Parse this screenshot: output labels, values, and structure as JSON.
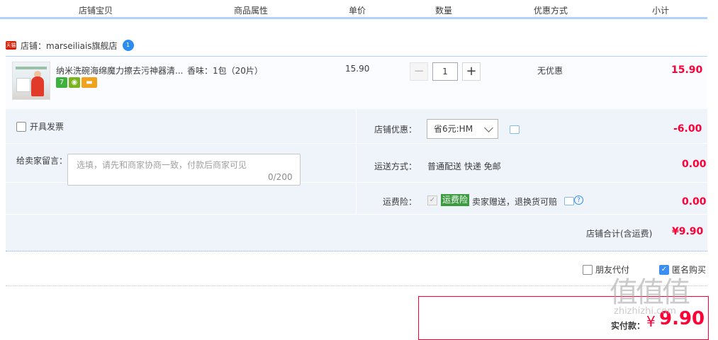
{
  "columns": [
    "店铺宝贝",
    "商品属性",
    "单价",
    "数量",
    "优惠方式",
    "小计"
  ],
  "shop": {
    "badge": "天猫",
    "name": "店铺：marseiliais旗舰店",
    "chat_badge": "1"
  },
  "item": {
    "title": "纳米洗碗海绵魔力擦去污神器清...",
    "attribute": "香味：1包（20片）",
    "price": "15.90",
    "badge_7": "7",
    "quantity": "1",
    "minus": "−",
    "plus": "+",
    "promo": "无优惠",
    "subtotal": "15.90"
  },
  "options": {
    "invoice_label": "开具发票",
    "message_label": "给卖家留言：",
    "message_placeholder": "选填，请先和商家协商一致，付款后商家可见",
    "message_count": "0/200",
    "shop_discount_label": "店铺优惠：",
    "shop_discount_select": "省6元:HM",
    "shop_discount_value": "-6.00",
    "shipping_label": "运送方式：",
    "shipping_method": "普通配送 快递 免邮",
    "shipping_value": "0.00",
    "insurance_label": "运费险：",
    "insurance_tag": "运费险",
    "insurance_text": "卖家赠送，退换货可赔",
    "insurance_value": "0.00",
    "total_label": "店铺合计(含运费)",
    "total_value": "¥9.90"
  },
  "footer": {
    "friend_pay": "朋友代付",
    "anonymous": "匿名购买",
    "pay_label": "实付款：",
    "pay_currency": "¥",
    "pay_amount": "9.90"
  },
  "watermark": {
    "big": "值值值",
    "small": "zhizhizhi.com"
  }
}
